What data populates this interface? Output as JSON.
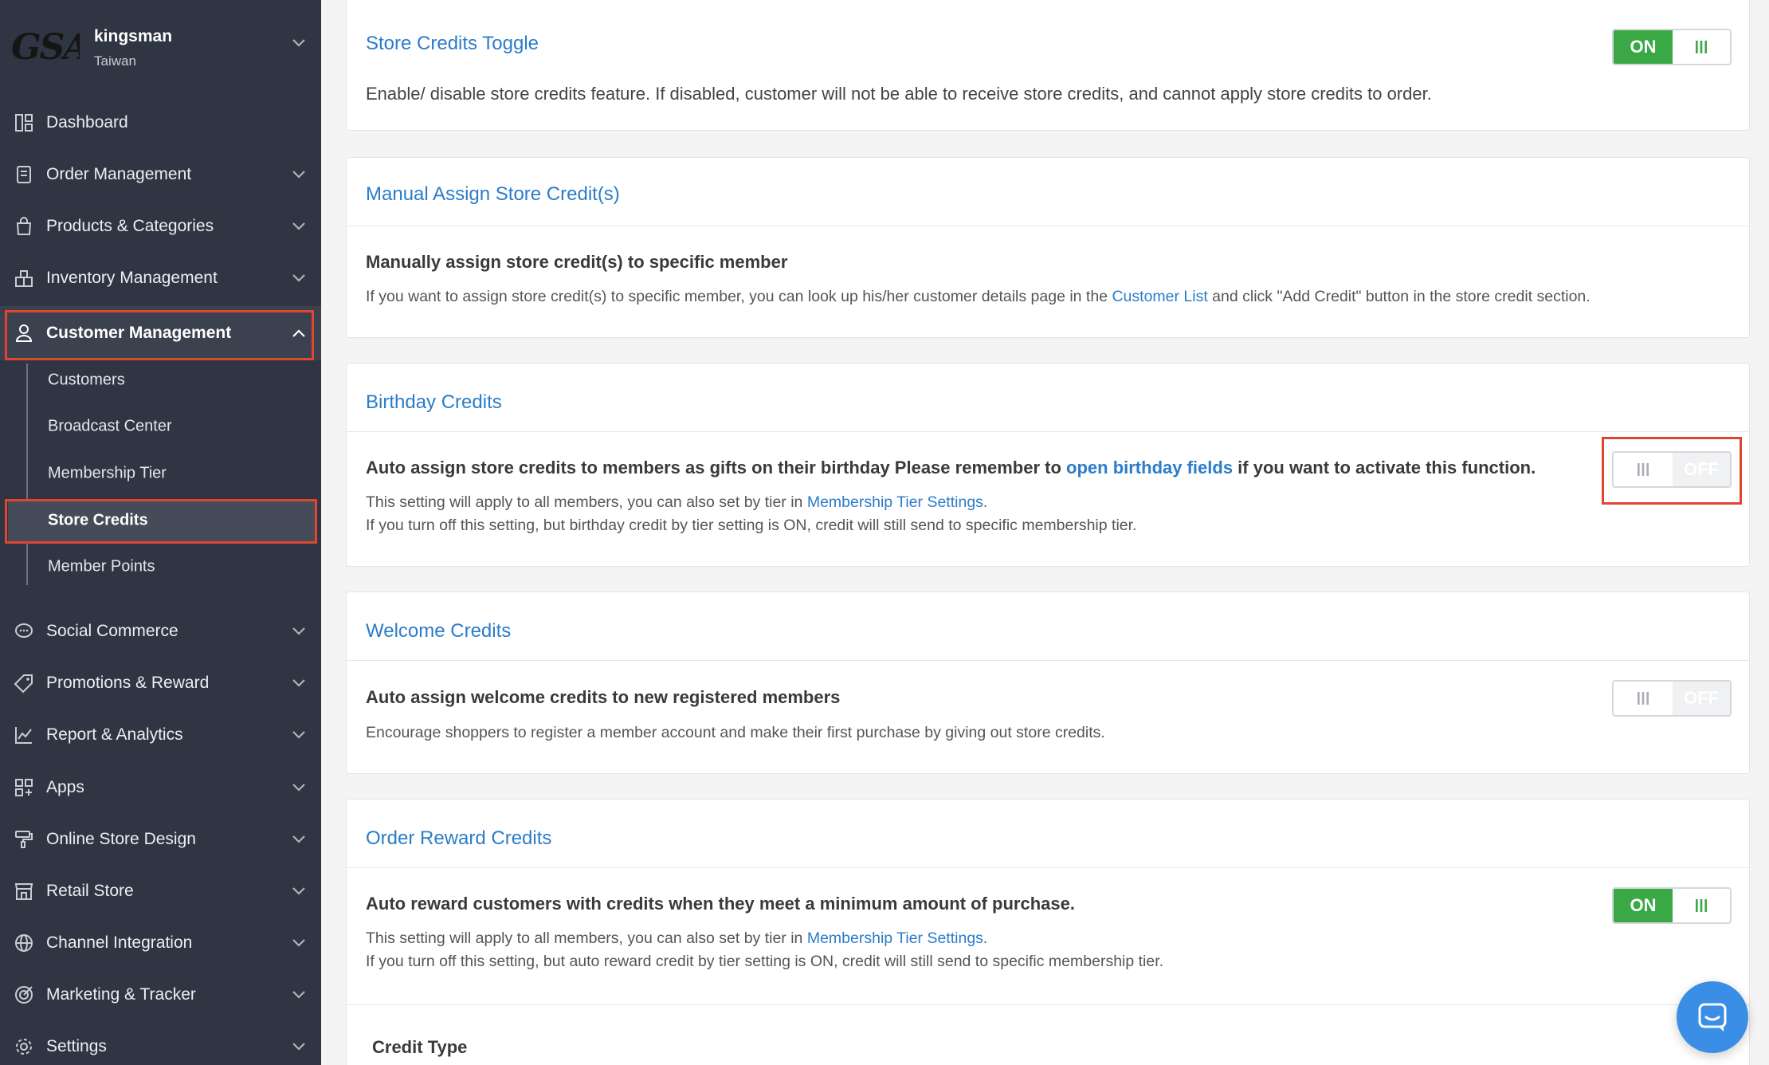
{
  "merchant": {
    "logo_text": "GSA",
    "name": "kingsman",
    "region": "Taiwan"
  },
  "nav": {
    "dashboard": "Dashboard",
    "order_management": "Order Management",
    "products_categories": "Products & Categories",
    "inventory_management": "Inventory Management",
    "customer_management": "Customer Management",
    "sub": {
      "customers": "Customers",
      "broadcast_center": "Broadcast Center",
      "membership_tier": "Membership Tier",
      "store_credits": "Store Credits",
      "member_points": "Member Points"
    },
    "social_commerce": "Social Commerce",
    "promotions_reward": "Promotions & Reward",
    "report_analytics": "Report & Analytics",
    "apps": "Apps",
    "online_store_design": "Online Store Design",
    "retail_store": "Retail Store",
    "channel_integration": "Channel Integration",
    "marketing_tracker": "Marketing & Tracker",
    "settings": "Settings"
  },
  "toggle_labels": {
    "on": "ON",
    "off": "OFF"
  },
  "store_credits_toggle": {
    "title": "Store Credits Toggle",
    "state": "ON",
    "description": "Enable/ disable store credits feature. If disabled, customer will not be able to receive store credits, and cannot apply store credits to order."
  },
  "manual_assign": {
    "title": "Manual Assign Store Credit(s)",
    "heading": "Manually assign store credit(s) to specific member",
    "desc_before": "If you want to assign store credit(s) to specific member, you can look up his/her customer details page in the ",
    "link": "Customer List",
    "desc_after": " and click \"Add Credit\" button in the store credit section."
  },
  "birthday": {
    "title": "Birthday Credits",
    "heading_before": "Auto assign store credits to members as gifts on their birthday Please remember to ",
    "heading_link": "open birthday fields",
    "heading_after": " if you want to activate this function.",
    "line1_before": "This setting will apply to all members, you can also set by tier in ",
    "line1_link": "Membership Tier Settings",
    "line1_after": ".",
    "line2": "If you turn off this setting, but birthday credit by tier setting is ON, credit will still send to specific membership tier.",
    "state": "OFF"
  },
  "welcome": {
    "title": "Welcome Credits",
    "heading": "Auto assign welcome credits to new registered members",
    "desc": "Encourage shoppers to register a member account and make their first purchase by giving out store credits.",
    "state": "OFF"
  },
  "order_reward": {
    "title": "Order Reward Credits",
    "heading": "Auto reward customers with credits when they meet a minimum amount of purchase.",
    "line1_before": "This setting will apply to all members, you can also set by tier in ",
    "line1_link": "Membership Tier Settings",
    "line1_after": ".",
    "line2": "If you turn off this setting, but auto reward credit by tier setting is ON, credit will still send to specific membership tier.",
    "credit_type_label": "Credit Type",
    "state": "ON"
  },
  "colors": {
    "sidebar": "#2f3542",
    "accent_blue": "#2b7cc9",
    "toggle_on": "#3aa845",
    "highlight": "#e0452f"
  }
}
